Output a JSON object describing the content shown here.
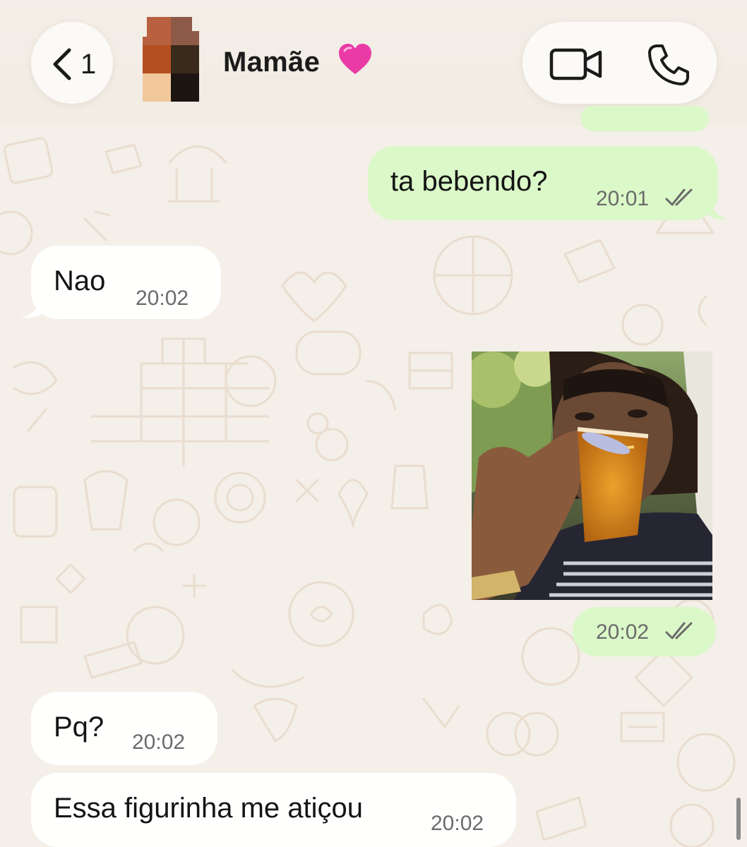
{
  "header": {
    "unread_count": "1",
    "contact_name": "Mamãe",
    "heart_icon": "heart-icon",
    "back_icon": "chevron-left-icon",
    "video_icon": "video-camera-icon",
    "call_icon": "phone-icon"
  },
  "messages": [
    {
      "direction": "outgoing",
      "text": "ta bebendo?",
      "time": "20:01",
      "status": "read"
    },
    {
      "direction": "incoming",
      "text": "Nao",
      "time": "20:02"
    },
    {
      "direction": "outgoing",
      "type": "sticker",
      "time": "20:02",
      "status": "read"
    },
    {
      "direction": "incoming",
      "text": "Pq?",
      "time": "20:02"
    },
    {
      "direction": "incoming",
      "text": "Essa figurinha me atiçou",
      "time": "20:02"
    }
  ],
  "colors": {
    "outgoing_bubble": "#dbf8c8",
    "incoming_bubble": "#fffffe",
    "background": "#f4efe8",
    "heart": "#e93aa6"
  }
}
